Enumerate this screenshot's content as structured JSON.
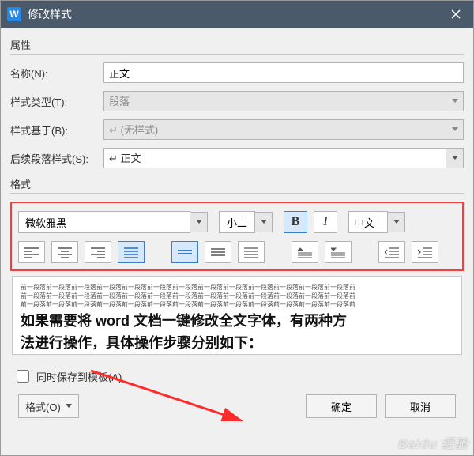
{
  "titlebar": {
    "icon": "W",
    "title": "修改样式"
  },
  "properties": {
    "legend": "属性",
    "name_label": "名称(N):",
    "name_value": "正文",
    "type_label": "样式类型(T):",
    "type_value": "段落",
    "based_label": "样式基于(B):",
    "based_value": "↵ (无样式)",
    "next_label": "后续段落样式(S):",
    "next_value": "↵ 正文"
  },
  "format": {
    "legend": "格式",
    "font_name": "微软雅黑",
    "font_size": "小二",
    "bold": "B",
    "italic": "I",
    "language": "中文"
  },
  "preview": {
    "tiny1": "前一段落前一段落前一段落前一段落前一段落前一段落前一段落前一段落前一段落前一段落前一段落前一段落前一段落前",
    "tiny2": "前一段落前一段落前一段落前一段落前一段落前一段落前一段落前一段落前一段落前一段落前一段落前一段落前一段落前",
    "tiny3": "前一段落前一段落前一段落前一段落前一段落前一段落前一段落前一段落前一段落前一段落前一段落前一段落前一段落前",
    "line1": "如果需要将 word 文档一键修改全文字体，有两种方",
    "line2": "法进行操作，具体操作步骤分别如下："
  },
  "save_template": "同时保存到模板(A)",
  "buttons": {
    "format": "格式(O)",
    "ok": "确定",
    "cancel": "取消"
  },
  "watermark": "Baidu 经验"
}
